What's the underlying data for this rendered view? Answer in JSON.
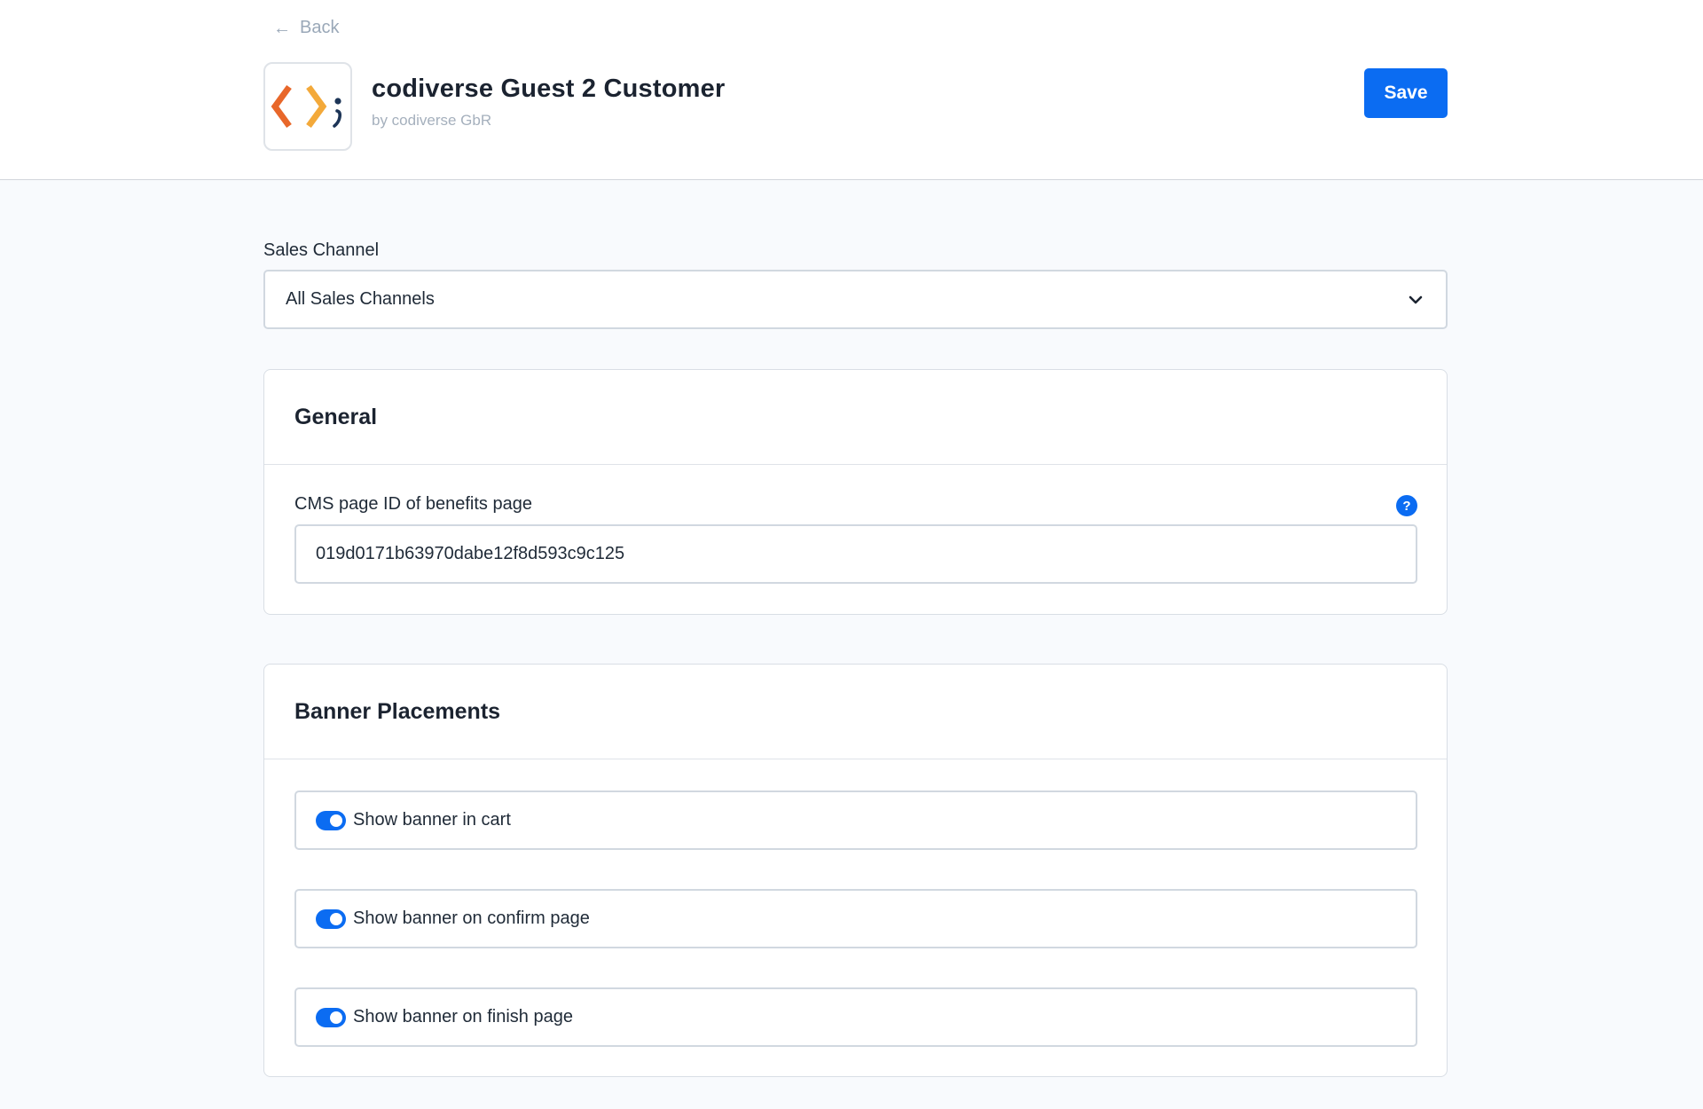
{
  "header": {
    "back_label": "Back",
    "app_title": "codiverse Guest 2 Customer",
    "app_vendor": "by codiverse GbR",
    "save_label": "Save",
    "logo_text": ";"
  },
  "sales_channel": {
    "label": "Sales Channel",
    "selected": "All Sales Channels"
  },
  "general": {
    "title": "General",
    "cms_label": "CMS page ID of benefits page",
    "cms_value": "019d0171b63970dabe12f8d593c9c125",
    "help_glyph": "?"
  },
  "banner": {
    "title": "Banner Placements",
    "toggles": [
      {
        "label": "Show banner in cart",
        "checked": true
      },
      {
        "label": "Show banner on confirm page",
        "checked": true
      },
      {
        "label": "Show banner on finish page",
        "checked": true
      }
    ]
  },
  "colors": {
    "accent": "#0b6cf2",
    "logo_orange": "#e8672a",
    "logo_yellow": "#f3a93a",
    "logo_navy": "#1d3557"
  },
  "icons": [
    "back-arrow-icon",
    "chevron-down-icon",
    "help-icon",
    "codiverse-logo-icon"
  ]
}
